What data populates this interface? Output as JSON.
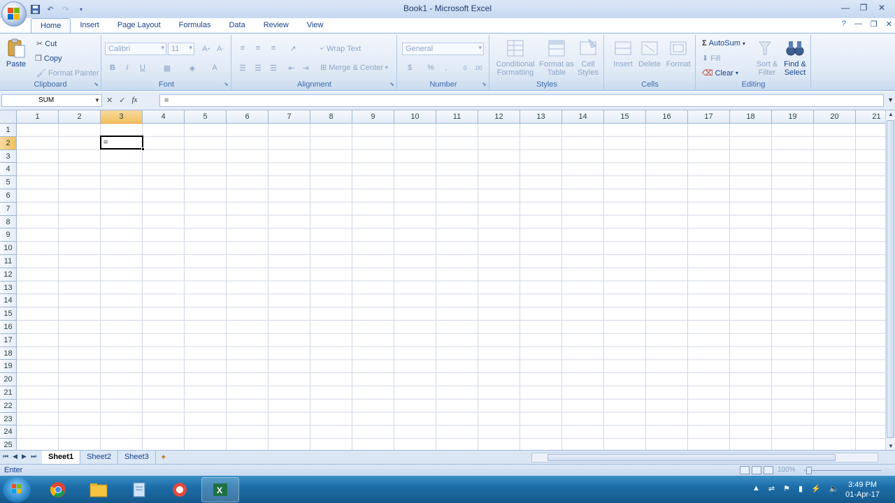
{
  "window": {
    "title": "Book1 - Microsoft Excel"
  },
  "tabs": [
    "Home",
    "Insert",
    "Page Layout",
    "Formulas",
    "Data",
    "Review",
    "View"
  ],
  "ribbon": {
    "clipboard": {
      "label": "Clipboard",
      "paste": "Paste",
      "cut": "Cut",
      "copy": "Copy",
      "format_painter": "Format Painter"
    },
    "font": {
      "label": "Font",
      "font_name": "Calibri",
      "font_size": "11",
      "bold": "B",
      "italic": "I",
      "underline": "U"
    },
    "alignment": {
      "label": "Alignment",
      "wrap_text": "Wrap Text",
      "merge_center": "Merge & Center"
    },
    "number": {
      "label": "Number",
      "format": "General"
    },
    "styles": {
      "label": "Styles",
      "conditional": "Conditional Formatting",
      "format_table": "Format as Table",
      "cell_styles": "Cell Styles"
    },
    "cells": {
      "label": "Cells",
      "insert": "Insert",
      "delete": "Delete",
      "format": "Format"
    },
    "editing": {
      "label": "Editing",
      "autosum": "AutoSum",
      "fill": "Fill",
      "clear": "Clear",
      "sort_filter": "Sort & Filter",
      "find_select": "Find & Select"
    }
  },
  "formula_bar": {
    "name_box": "SUM",
    "formula": "="
  },
  "grid": {
    "columns": [
      "1",
      "2",
      "3",
      "4",
      "5",
      "6",
      "7",
      "8",
      "9",
      "10",
      "11",
      "12",
      "13",
      "14",
      "15",
      "16",
      "17",
      "18",
      "19",
      "20",
      "21"
    ],
    "rows": [
      "1",
      "2",
      "3",
      "4",
      "5",
      "6",
      "7",
      "8",
      "9",
      "10",
      "11",
      "12",
      "13",
      "14",
      "15",
      "16",
      "17",
      "18",
      "19",
      "20",
      "21",
      "22",
      "23",
      "24",
      "25"
    ],
    "active_cell_value": "="
  },
  "sheets": [
    "Sheet1",
    "Sheet2",
    "Sheet3"
  ],
  "status": {
    "mode": "Enter",
    "zoom": "100%"
  },
  "taskbar": {
    "time": "3:49 PM",
    "date": "01-Apr-17"
  }
}
